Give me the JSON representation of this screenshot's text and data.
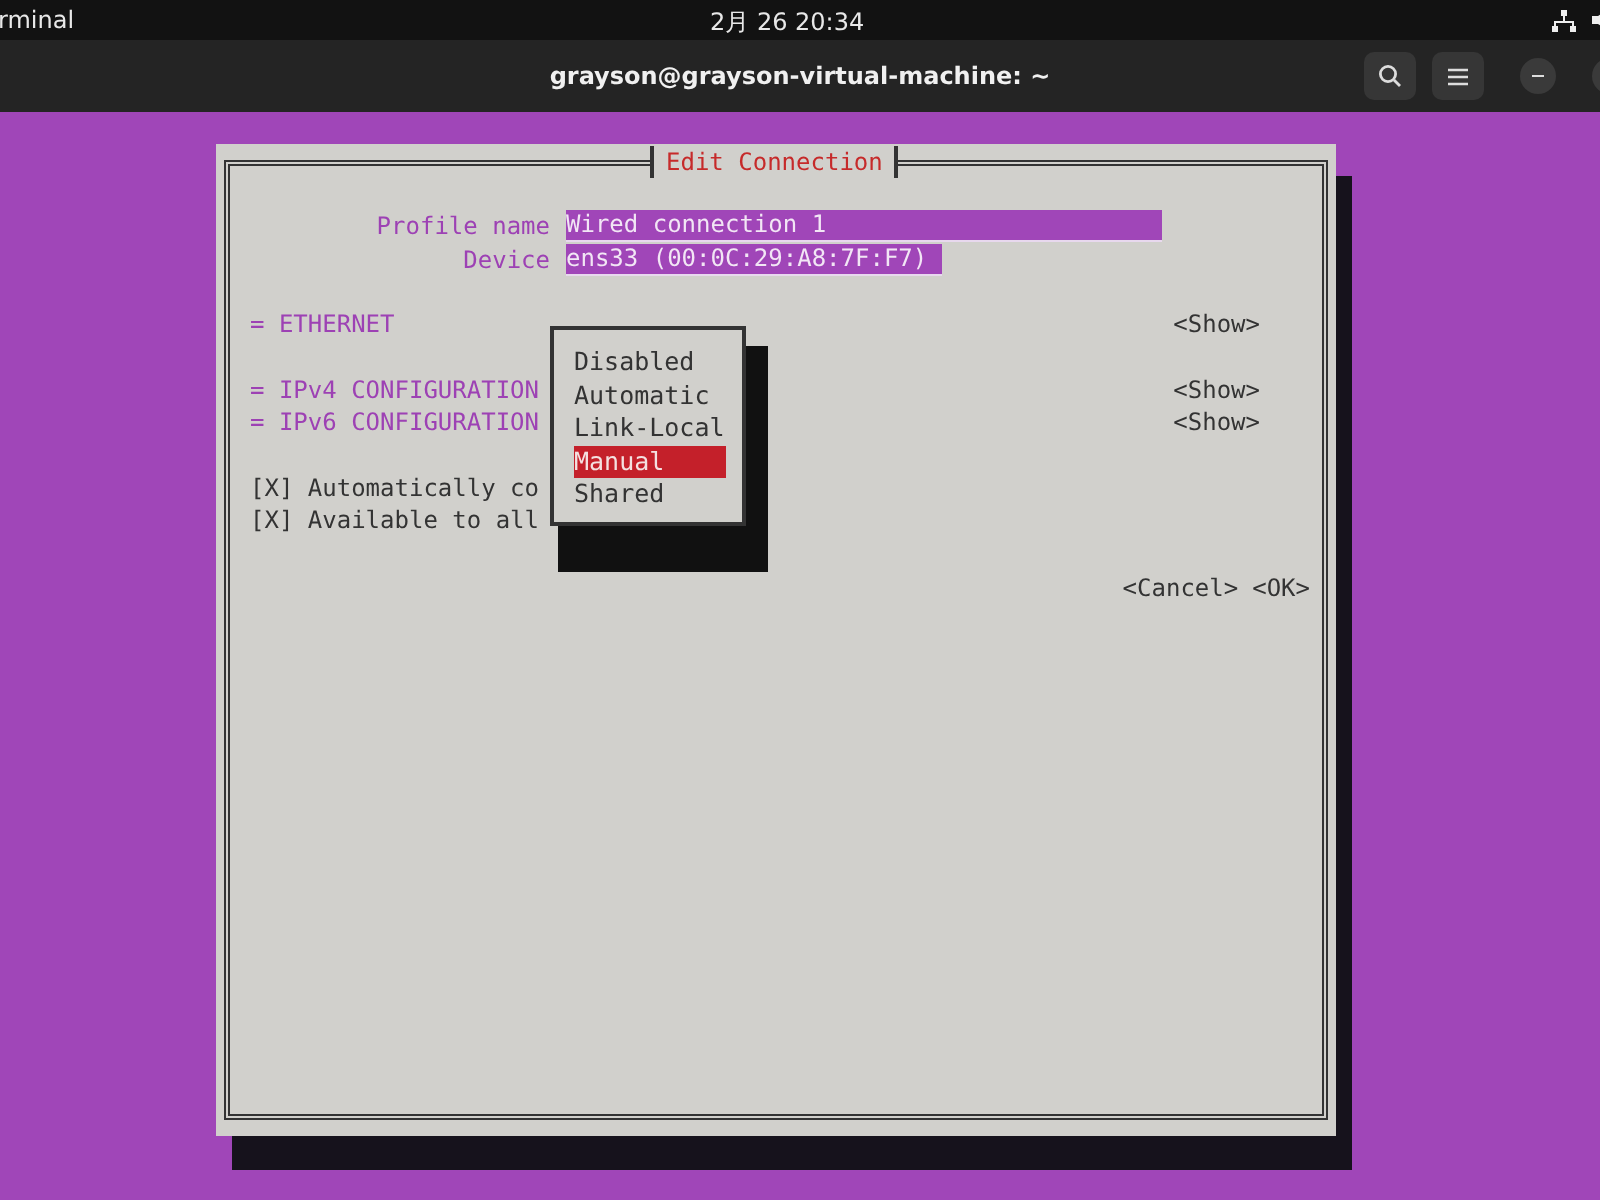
{
  "topbar": {
    "app": "rminal",
    "clock": "2月 26  20:34"
  },
  "terminal": {
    "title": "grayson@grayson-virtual-machine: ~"
  },
  "dialog": {
    "title": "Edit Connection",
    "fields": [
      {
        "label": "Profile name",
        "value": "Wired connection 1"
      },
      {
        "label": "Device",
        "value": "ens33 (00:0C:29:A8:7F:F7)"
      }
    ],
    "sections": [
      {
        "label": "= ETHERNET",
        "action": "<Show>"
      },
      {
        "label": "= IPv4 CONFIGURATION",
        "action": "<Show>"
      },
      {
        "label": "= IPv6 CONFIGURATION",
        "action": "<Show>"
      }
    ],
    "checkboxes": [
      {
        "text": "[X] Automatically co"
      },
      {
        "text": "[X] Available to all"
      }
    ],
    "buttons": [
      "<Cancel>",
      "<OK>"
    ]
  },
  "popup": {
    "options": [
      {
        "label": "Disabled",
        "selected": false
      },
      {
        "label": "Automatic",
        "selected": false
      },
      {
        "label": "Link-Local",
        "selected": false
      },
      {
        "label": "Manual",
        "selected": true
      },
      {
        "label": "Shared",
        "selected": false
      }
    ]
  }
}
